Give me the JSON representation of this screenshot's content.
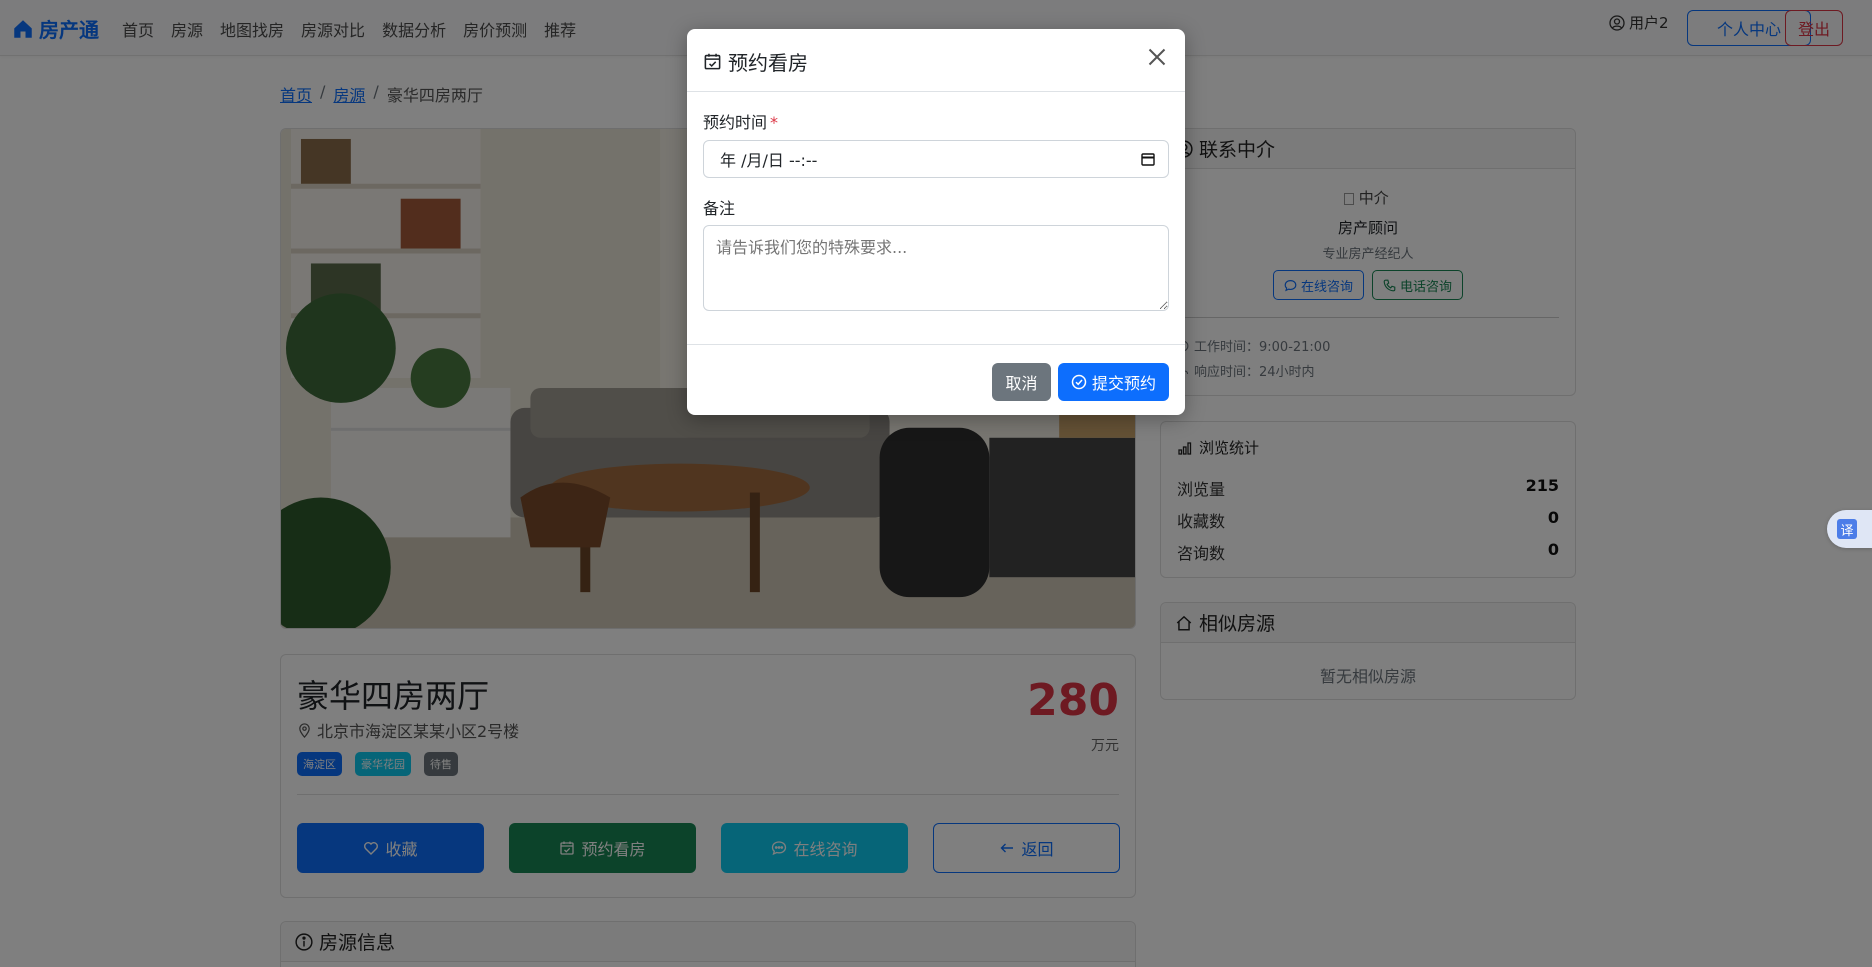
{
  "navbar": {
    "brand": "房产通",
    "links": [
      "首页",
      "房源",
      "地图找房",
      "房源对比",
      "数据分析",
      "房价预测",
      "推荐"
    ],
    "user": "用户2",
    "profile_button": "个人中心",
    "logout_button": "登出"
  },
  "breadcrumb": {
    "home": "首页",
    "listings": "房源",
    "current": "豪华四房两厅"
  },
  "house": {
    "title": "豪华四房两厅",
    "address": "北京市海淀区某某小区2号楼",
    "tags": [
      {
        "label": "海淀区",
        "color": "#0d6efd"
      },
      {
        "label": "豪华花园",
        "color": "#0dcaf0"
      },
      {
        "label": "待售",
        "color": "#6c757d"
      }
    ],
    "price": "280",
    "price_unit": "万元",
    "actions": {
      "favorite": "收藏",
      "book": "预约看房",
      "consult": "在线咨询",
      "back": "返回"
    }
  },
  "info_section": {
    "title": "房源信息"
  },
  "agent": {
    "header": "联系中介",
    "image_alt": "中介",
    "name": "房产顾问",
    "desc": "专业房产经纪人",
    "online_button": "在线咨询",
    "phone_button": "电话咨询",
    "work_hours": "工作时间：9:00-21:00",
    "response_time": "响应时间：24小时内"
  },
  "stats": {
    "title": "浏览统计",
    "rows": [
      {
        "label": "浏览量",
        "value": "215"
      },
      {
        "label": "收藏数",
        "value": "0"
      },
      {
        "label": "咨询数",
        "value": "0"
      }
    ]
  },
  "similar": {
    "header": "相似房源",
    "empty": "暂无相似房源"
  },
  "translate": {
    "label": "译"
  },
  "modal": {
    "title": "预约看房",
    "time_label": "预约时间",
    "required_mark": "*",
    "date_value": "年 /月/日 --:--",
    "note_label": "备注",
    "note_placeholder": "请告诉我们您的特殊要求...",
    "cancel_button": "取消",
    "submit_button": "提交预约"
  },
  "colors": {
    "primary": "#0d6efd",
    "success": "#198754",
    "info": "#0dcaf0",
    "danger": "#dc3545",
    "secondary": "#6c757d"
  }
}
